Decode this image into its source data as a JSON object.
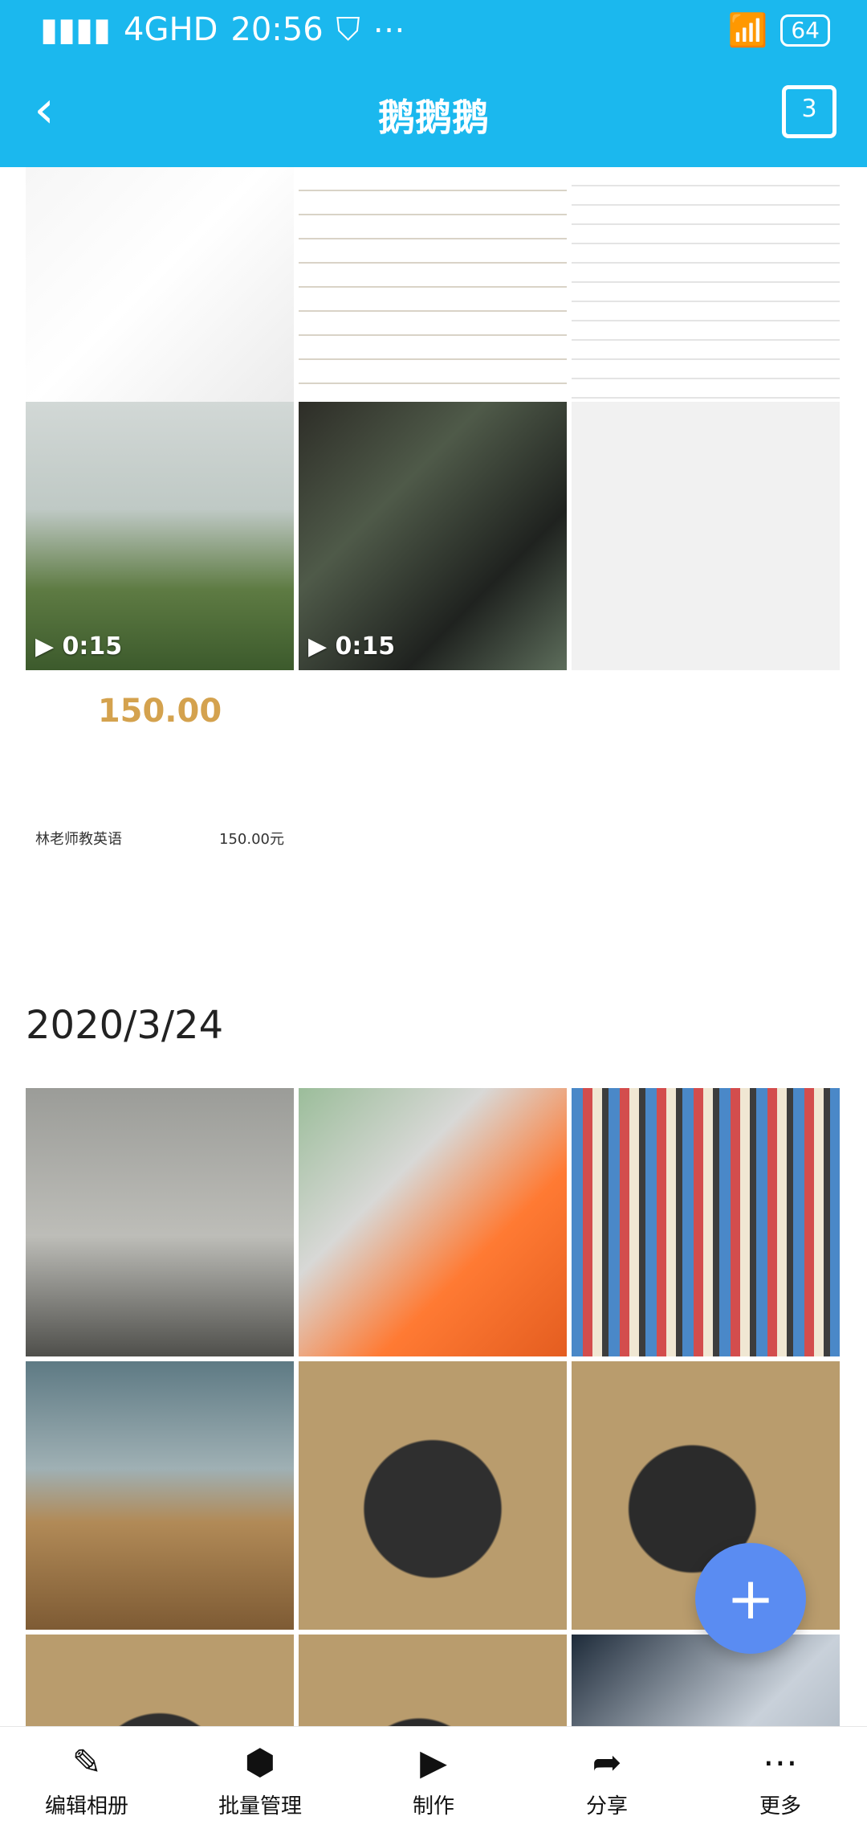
{
  "status_bar": {
    "network": "4GHD",
    "time": "20:56",
    "battery": "64"
  },
  "header": {
    "title": "鹅鹅鹅"
  },
  "tiles_section_1": [
    {
      "kind": "image",
      "label": ""
    },
    {
      "kind": "image",
      "label": ""
    },
    {
      "kind": "image",
      "label": ""
    },
    {
      "kind": "video",
      "duration": "0:15"
    },
    {
      "kind": "video",
      "duration": "0:15"
    },
    {
      "kind": "image",
      "label": ""
    },
    {
      "kind": "receipt",
      "amount": "150.00",
      "name": "林老师教英语",
      "value": "150.00元"
    }
  ],
  "section_date": "2020/3/24",
  "bottom_nav": [
    {
      "label": "编辑相册",
      "icon": "edit-icon"
    },
    {
      "label": "批量管理",
      "icon": "batch-manage-icon"
    },
    {
      "label": "制作",
      "icon": "video-make-icon"
    },
    {
      "label": "分享",
      "icon": "share-icon"
    },
    {
      "label": "更多",
      "icon": "more-icon"
    }
  ],
  "fab": {
    "symbol": "+"
  }
}
